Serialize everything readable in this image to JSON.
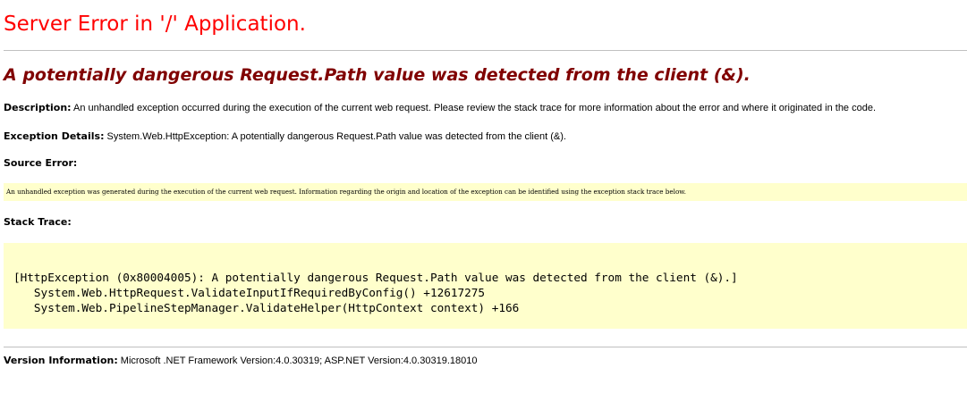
{
  "page": {
    "title": "Server Error in '/' Application.",
    "subtitle": "A potentially dangerous Request.Path value was detected from the client (&).",
    "description": {
      "label": "Description:",
      "text": " An unhandled exception occurred during the execution of the current web request. Please review the stack trace for more information about the error and where it originated in the code."
    },
    "exception_details": {
      "label": "Exception Details:",
      "text": " System.Web.HttpException: A potentially dangerous Request.Path value was detected from the client (&)."
    },
    "source_error": {
      "label": "Source Error:",
      "text": "An unhandled exception was generated during the execution of the current web request. Information regarding the origin and location of the exception can be identified using the exception stack trace below."
    },
    "stack_trace": {
      "label": "Stack Trace:",
      "lines": [
        "[HttpException (0x80004005): A potentially dangerous Request.Path value was detected from the client (&).]",
        "   System.Web.HttpRequest.ValidateInputIfRequiredByConfig() +12617275",
        "   System.Web.PipelineStepManager.ValidateHelper(HttpContext context) +166"
      ]
    },
    "version_info": {
      "label": "Version Information:",
      "text": " Microsoft .NET Framework Version:4.0.30319; ASP.NET Version:4.0.30319.18010"
    },
    "colors": {
      "title": "#ff0000",
      "subtitle": "#800000",
      "code_background": "#ffffcc",
      "rule": "#c0c0c0"
    }
  }
}
